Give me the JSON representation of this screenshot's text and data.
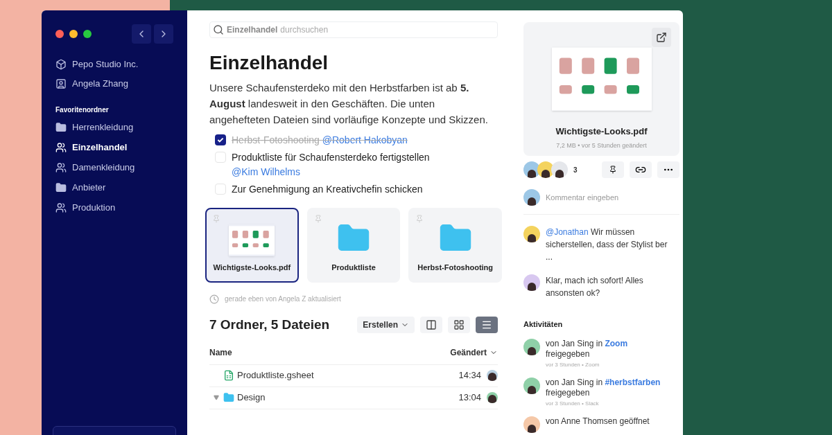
{
  "sidebar": {
    "accounts": [
      {
        "kind": "dropbox",
        "label": "Pepo Studio Inc."
      },
      {
        "kind": "person",
        "label": "Angela Zhang"
      }
    ],
    "section_title": "Favoritenordner",
    "items": [
      {
        "kind": "folder",
        "label": "Herrenkleidung",
        "selected": false
      },
      {
        "kind": "shared",
        "label": "Einzelhandel",
        "selected": true
      },
      {
        "kind": "shared",
        "label": "Damenkleidung",
        "selected": false
      },
      {
        "kind": "folder",
        "label": "Anbieter",
        "selected": false
      },
      {
        "kind": "shared",
        "label": "Produktion",
        "selected": false
      }
    ]
  },
  "search": {
    "scope": "Einzelhandel",
    "placeholder": "durchsuchen"
  },
  "title": "Einzelhandel",
  "description": "Unsere Schaufensterdeko mit den Herbstfarben ist ab **5. August** landesweit in den Geschäften. Die unten angehefteten Dateien sind vorläufige Konzepte und Skizzen.",
  "tasks": [
    {
      "text": "Herbst-Fotoshooting",
      "mention": "@Robert Hakobyan",
      "checked": true
    },
    {
      "text": "Produktliste für Schaufensterdeko fertigstellen",
      "mention": "@Kim Wilhelms",
      "checked": false
    },
    {
      "text": "Zur Genehmigung an Kreativchefin schicken",
      "checked": false
    }
  ],
  "pinned": [
    {
      "kind": "pdf",
      "label": "Wichtigste-Looks.pdf",
      "selected": true
    },
    {
      "kind": "folder",
      "label": "Produktliste",
      "selected": false
    },
    {
      "kind": "folder",
      "label": "Herbst-Fotoshooting",
      "selected": false
    }
  ],
  "updated": "gerade eben von Angela Z aktualisiert",
  "listing": {
    "title": "7 Ordner, 5 Dateien",
    "create": "Erstellen",
    "views": [
      {
        "kind": "split",
        "selected": false
      },
      {
        "kind": "grid",
        "selected": false
      },
      {
        "kind": "list",
        "selected": true
      }
    ],
    "columns": [
      "Name",
      "Geändert"
    ],
    "rows": [
      {
        "kind": "file",
        "name": "Produktliste.gsheet",
        "time": "14:34"
      },
      {
        "kind": "folder",
        "name": "Design",
        "time": "13:04",
        "expanded": true
      }
    ]
  },
  "preview": {
    "name": "Wichtigste-Looks.pdf",
    "meta": "7,2 MB • vor 5 Stunden geändert",
    "viewer_count": "3"
  },
  "comment_placeholder": "Kommentar eingeben",
  "comments": [
    {
      "mention": "@Jonathan",
      "text": "Wir müssen sicherstellen, dass der Stylist ber ..."
    },
    {
      "text": "Klar, mach ich sofort! Alles ansonsten ok?"
    }
  ],
  "activity_title": "Aktivitäten",
  "activities": [
    {
      "text": "von Jan Sing in",
      "link": "Zoom",
      "text2": "freigegeben",
      "meta": "vor 3 Stunden • Zoom"
    },
    {
      "text": "von Jan Sing in",
      "link": "#herbstfarben",
      "text2": "freigegeben",
      "meta": "vor 3 Stunden • Slack"
    },
    {
      "text": "von Anne Thomsen geöffnet"
    }
  ]
}
